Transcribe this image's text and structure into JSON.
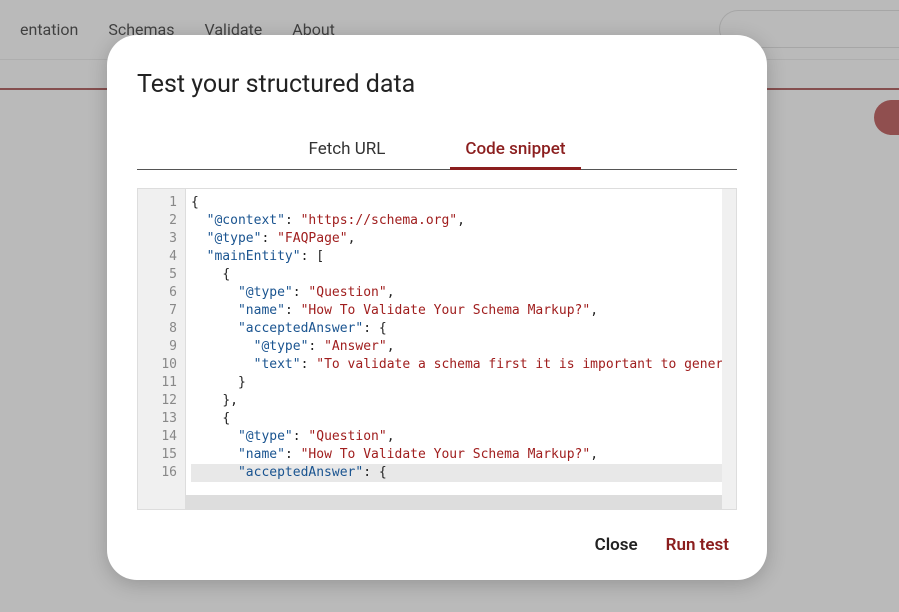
{
  "nav": {
    "items": [
      "entation",
      "Schemas",
      "Validate",
      "About"
    ]
  },
  "modal": {
    "title": "Test your structured data",
    "tabs": {
      "fetch_url": "Fetch URL",
      "code_snippet": "Code snippet"
    },
    "footer": {
      "close": "Close",
      "run": "Run test"
    }
  },
  "code": {
    "line_numbers": [
      "1",
      "2",
      "3",
      "4",
      "5",
      "6",
      "7",
      "8",
      "9",
      "10",
      "11",
      "12",
      "13",
      "14",
      "15",
      "16"
    ],
    "lines": [
      {
        "indent": 0,
        "tokens": [
          {
            "t": "punct",
            "v": "{"
          }
        ]
      },
      {
        "indent": 1,
        "tokens": [
          {
            "t": "key",
            "v": "\"@context\""
          },
          {
            "t": "punct",
            "v": ": "
          },
          {
            "t": "str",
            "v": "\"https://schema.org\""
          },
          {
            "t": "punct",
            "v": ","
          }
        ]
      },
      {
        "indent": 1,
        "tokens": [
          {
            "t": "key",
            "v": "\"@type\""
          },
          {
            "t": "punct",
            "v": ": "
          },
          {
            "t": "str",
            "v": "\"FAQPage\""
          },
          {
            "t": "punct",
            "v": ","
          }
        ]
      },
      {
        "indent": 1,
        "tokens": [
          {
            "t": "key",
            "v": "\"mainEntity\""
          },
          {
            "t": "punct",
            "v": ": ["
          }
        ]
      },
      {
        "indent": 2,
        "tokens": [
          {
            "t": "punct",
            "v": "{"
          }
        ]
      },
      {
        "indent": 3,
        "tokens": [
          {
            "t": "key",
            "v": "\"@type\""
          },
          {
            "t": "punct",
            "v": ": "
          },
          {
            "t": "str",
            "v": "\"Question\""
          },
          {
            "t": "punct",
            "v": ","
          }
        ]
      },
      {
        "indent": 3,
        "tokens": [
          {
            "t": "key",
            "v": "\"name\""
          },
          {
            "t": "punct",
            "v": ": "
          },
          {
            "t": "str",
            "v": "\"How To Validate Your Schema Markup?\""
          },
          {
            "t": "punct",
            "v": ","
          }
        ]
      },
      {
        "indent": 3,
        "tokens": [
          {
            "t": "key",
            "v": "\"acceptedAnswer\""
          },
          {
            "t": "punct",
            "v": ": {"
          }
        ]
      },
      {
        "indent": 4,
        "tokens": [
          {
            "t": "key",
            "v": "\"@type\""
          },
          {
            "t": "punct",
            "v": ": "
          },
          {
            "t": "str",
            "v": "\"Answer\""
          },
          {
            "t": "punct",
            "v": ","
          }
        ]
      },
      {
        "indent": 4,
        "tokens": [
          {
            "t": "key",
            "v": "\"text\""
          },
          {
            "t": "punct",
            "v": ": "
          },
          {
            "t": "str",
            "v": "\"To validate a schema first it is important to generate a sch"
          }
        ]
      },
      {
        "indent": 3,
        "tokens": [
          {
            "t": "punct",
            "v": "}"
          }
        ]
      },
      {
        "indent": 2,
        "tokens": [
          {
            "t": "punct",
            "v": "},"
          }
        ]
      },
      {
        "indent": 2,
        "tokens": [
          {
            "t": "punct",
            "v": "{"
          }
        ]
      },
      {
        "indent": 3,
        "tokens": [
          {
            "t": "key",
            "v": "\"@type\""
          },
          {
            "t": "punct",
            "v": ": "
          },
          {
            "t": "str",
            "v": "\"Question\""
          },
          {
            "t": "punct",
            "v": ","
          }
        ]
      },
      {
        "indent": 3,
        "tokens": [
          {
            "t": "key",
            "v": "\"name\""
          },
          {
            "t": "punct",
            "v": ": "
          },
          {
            "t": "str",
            "v": "\"How To Validate Your Schema Markup?\""
          },
          {
            "t": "punct",
            "v": ","
          }
        ]
      },
      {
        "indent": 3,
        "tokens": [
          {
            "t": "key",
            "v": "\"acceptedAnswer\""
          },
          {
            "t": "punct",
            "v": ": {"
          }
        ],
        "highlight": true
      }
    ]
  }
}
